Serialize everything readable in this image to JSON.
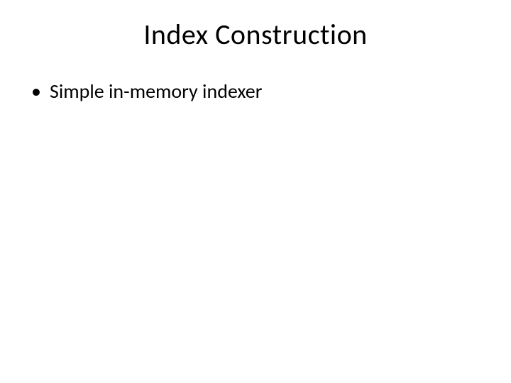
{
  "slide": {
    "title": "Index Construction",
    "bullets": [
      {
        "text": "Simple in-memory indexer"
      }
    ]
  }
}
